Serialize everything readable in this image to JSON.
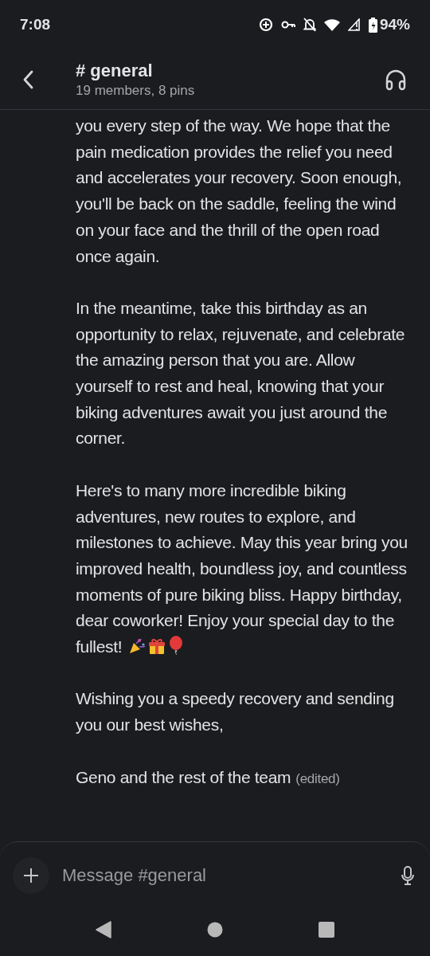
{
  "status_bar": {
    "time": "7:08",
    "battery": "94%"
  },
  "header": {
    "title": "# general",
    "subtitle": "19 members, 8 pins"
  },
  "message": {
    "paragraphs": [
      "you every step of the way. We hope that the pain medication provides the relief you need and accelerates your recovery. Soon enough, you'll be back on the saddle, feeling the wind on your face and the thrill of the open road once again.",
      "In the meantime, take this birthday as an opportunity to relax, rejuvenate, and celebrate the amazing person that you are. Allow yourself to rest and heal, knowing that your biking adventures await you just around the corner.",
      "Here's to many more incredible biking adventures, new routes to explore, and milestones to achieve. May this year bring you improved health, boundless joy, and countless moments of pure biking bliss. Happy birthday, dear coworker! Enjoy your special day to the",
      "fullest!",
      "Wishing you a speedy recovery and sending you our best wishes,",
      "Geno and the rest of the team"
    ],
    "edited": "(edited)"
  },
  "composer": {
    "placeholder": "Message #general"
  }
}
